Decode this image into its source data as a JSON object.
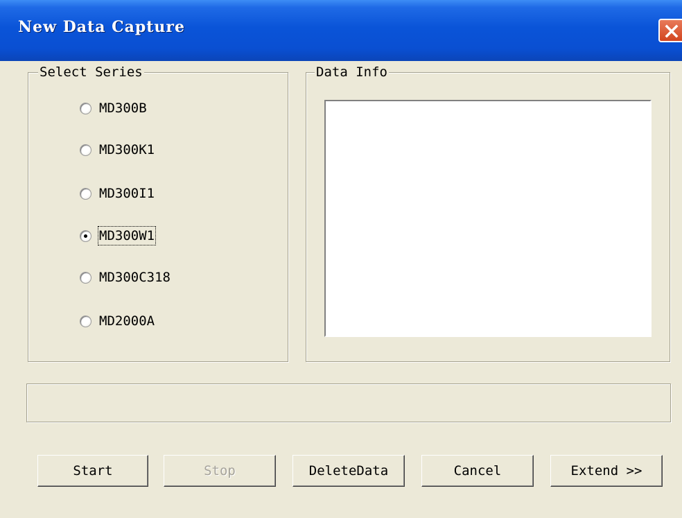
{
  "window": {
    "title": "New Data Capture"
  },
  "select_series": {
    "legend": "Select Series",
    "options": [
      {
        "label": "MD300B",
        "selected": false
      },
      {
        "label": "MD300K1",
        "selected": false
      },
      {
        "label": "MD300I1",
        "selected": false
      },
      {
        "label": "MD300W1",
        "selected": true
      },
      {
        "label": "MD300C318",
        "selected": false
      },
      {
        "label": "MD2000A",
        "selected": false
      }
    ]
  },
  "data_info": {
    "legend": "Data Info",
    "content": ""
  },
  "status_text": "",
  "buttons": {
    "start": {
      "label": "Start",
      "enabled": true
    },
    "stop": {
      "label": "Stop",
      "enabled": false
    },
    "delete_data": {
      "label": "DeleteData",
      "enabled": true
    },
    "cancel": {
      "label": "Cancel",
      "enabled": true
    },
    "extend": {
      "label": "Extend >>",
      "enabled": true
    }
  },
  "colors": {
    "titlebar": "#0a54d8",
    "dialog_background": "#ece9d8",
    "close_button": "#d24520"
  },
  "icons": {
    "close": "close-icon"
  }
}
